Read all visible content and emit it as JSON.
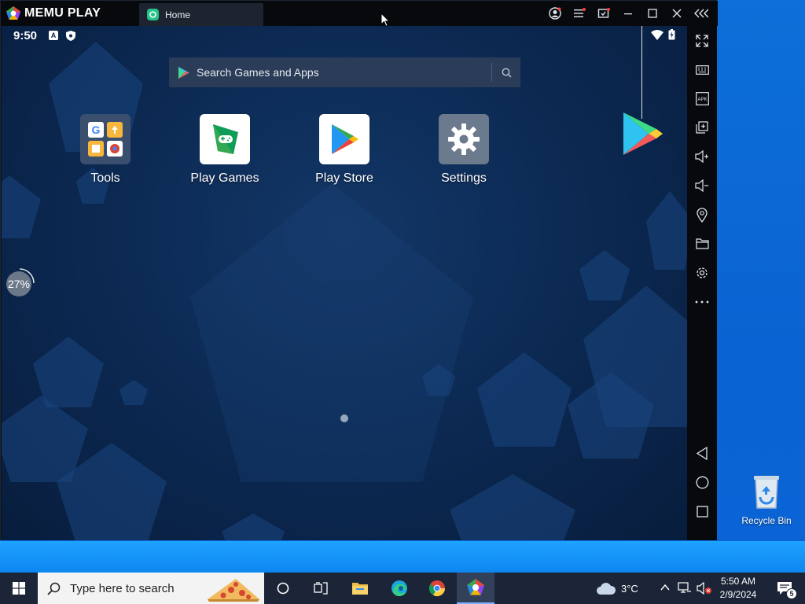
{
  "window": {
    "app_name": "MEMU PLAY",
    "tab_label": "Home"
  },
  "android": {
    "clock": "9:50",
    "search_placeholder": "Search Games and Apps",
    "apps": [
      {
        "label": "Tools"
      },
      {
        "label": "Play Games"
      },
      {
        "label": "Play Store"
      },
      {
        "label": "Settings"
      }
    ],
    "perf_badge": "27%"
  },
  "sidebar": {
    "items": [
      "fullscreen-icon",
      "keyboard-icon",
      "apk-icon",
      "multi-instance-icon",
      "volume-up-icon",
      "volume-down-icon",
      "location-icon",
      "folder-icon",
      "settings-icon",
      "more-icon",
      "back-icon",
      "home-icon",
      "recents-icon"
    ]
  },
  "desktop": {
    "recycle_bin_label": "Recycle Bin"
  },
  "taskbar": {
    "search_placeholder": "Type here to search",
    "weather": "3°C",
    "time": "5:50 AM",
    "date": "2/9/2024",
    "notification_count": "5"
  },
  "colors": {
    "titlebar": "#07090d",
    "accent_blue": "#0a63d2",
    "screen_bg": "#0c2a54"
  }
}
